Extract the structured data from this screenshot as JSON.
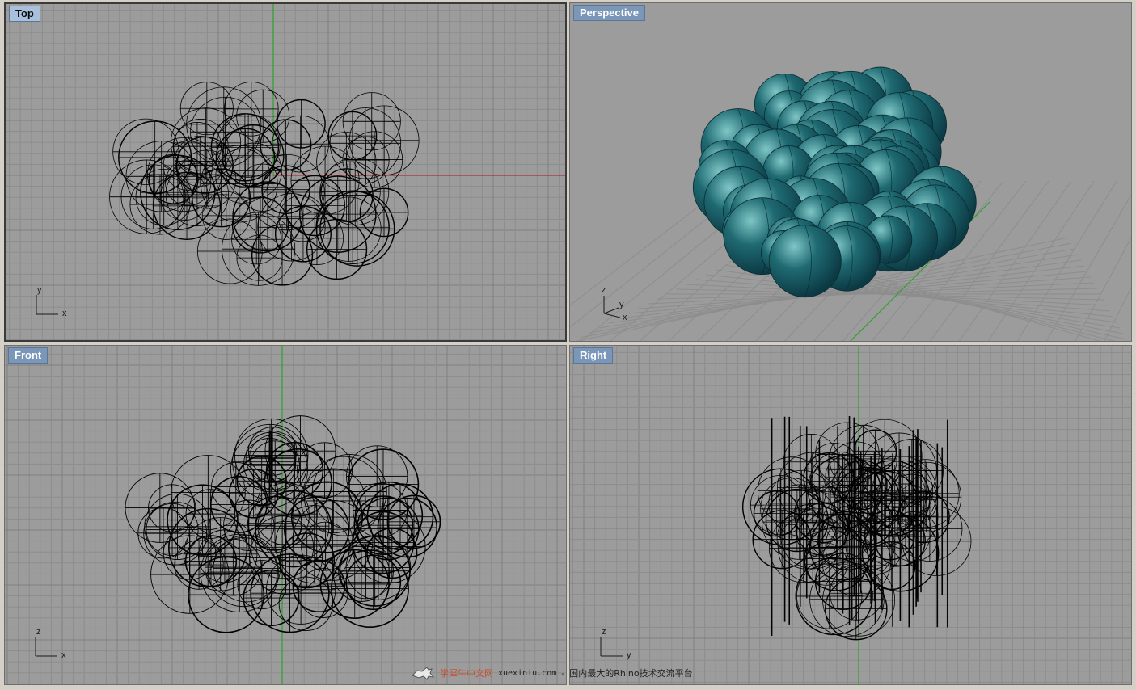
{
  "viewports": {
    "top": {
      "label": "Top",
      "axes": [
        "x",
        "y"
      ]
    },
    "perspective": {
      "label": "Perspective",
      "axes": [
        "x",
        "y",
        "z"
      ]
    },
    "front": {
      "label": "Front",
      "axes": [
        "x",
        "z"
      ]
    },
    "right": {
      "label": "Right",
      "axes": [
        "y",
        "z"
      ]
    }
  },
  "colors": {
    "viewport_bg": "#9c9c9c",
    "grid_minor": "#8d8d8d",
    "grid_major": "#7f7f7f",
    "x_axis": "#b03030",
    "y_axis": "#2fa02f",
    "wire": "#000000",
    "sphere_fill": "#1f6a72"
  },
  "watermark": {
    "brand": "学犀牛中文网",
    "url": "xuexiniu.com",
    "separator": "-",
    "slogan": "国内最大的Rhino技术交流平台"
  }
}
